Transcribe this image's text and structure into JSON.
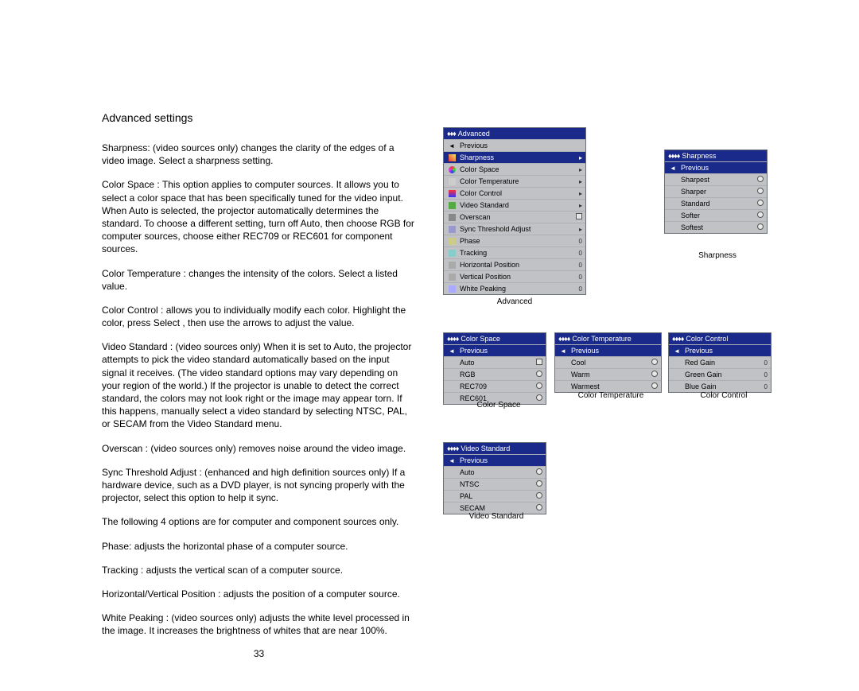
{
  "heading": "Advanced settings",
  "paragraphs": {
    "p1": "Sharpness: (video sources only) changes the clarity of the edges of a video image. Select a sharpness setting.",
    "p2": "Color Space : This option applies to computer sources. It allows you to select a color space that has been specifically tuned for the video input. When Auto is selected, the projector automatically determines the standard. To choose a different setting, turn off Auto, then choose RGB for computer sources, choose either REC709 or REC601 for component sources.",
    "p3": "Color Temperature   : changes the intensity of the colors. Select a listed value.",
    "p4": "Color Control   : allows you to individually modify each color. Highlight the color, press Select , then use the arrows to adjust the value.",
    "p5": "Video Standard  : (video sources only) When it is set to Auto, the projector attempts to pick the video standard automatically based on the input signal it receives. (The video standard options may vary depending on your region of the world.) If the projector is unable to detect the correct standard, the colors may not look right or the image may appear  torn.  If this happens, manually select a video standard by selecting NTSC, PAL, or SECAM from the Video Standard menu.",
    "p6": "Overscan : (video sources only) removes noise around the video image.",
    "p7": "Sync Threshold Adjust  : (enhanced and high definition sources only) If a hardware device, such as a DVD player, is not syncing properly with the projector, select this option to help it sync.",
    "p8": "The following 4 options are for computer and component sources only.",
    "p9": "Phase: adjusts the horizontal phase of a computer source.",
    "p10": "Tracking : adjusts the vertical scan of a computer source.",
    "p11": "Horizontal/Vertical Position    : adjusts the position of a computer source.",
    "p12": "White Peaking  : (video sources only) adjusts the white level processed in the image. It increases the brightness of whites that are near 100%."
  },
  "pageNumber": "33",
  "menus": {
    "advanced": {
      "title": "Advanced",
      "diam": "♦♦♦",
      "items": [
        {
          "label": "Previous",
          "icon": "prev",
          "ind": ""
        },
        {
          "label": "Sharpness",
          "icon": "sharp",
          "ind": "▸",
          "sel": true
        },
        {
          "label": "Color Space",
          "icon": "cs",
          "ind": "▸"
        },
        {
          "label": "Color Temperature",
          "icon": "ct",
          "ind": "▸"
        },
        {
          "label": "Color Control",
          "icon": "cc",
          "ind": "▸"
        },
        {
          "label": "Video Standard",
          "icon": "vs",
          "ind": "▸"
        },
        {
          "label": "Overscan",
          "icon": "os",
          "ind": "check"
        },
        {
          "label": "Sync Threshold Adjust",
          "icon": "st",
          "ind": "▸"
        },
        {
          "label": "Phase",
          "icon": "ph",
          "ind": "0"
        },
        {
          "label": "Tracking",
          "icon": "tr",
          "ind": "0"
        },
        {
          "label": "Horizontal Position",
          "icon": "hp",
          "ind": "0"
        },
        {
          "label": "Vertical Position",
          "icon": "vp",
          "ind": "0"
        },
        {
          "label": "White Peaking",
          "icon": "wp",
          "ind": "0"
        }
      ],
      "caption": "Advanced"
    },
    "sharpness": {
      "title": "Sharpness",
      "diam": "♦♦♦♦",
      "items": [
        {
          "label": "Previous",
          "sel": true,
          "ind": ""
        },
        {
          "label": "Sharpest",
          "ind": "radio"
        },
        {
          "label": "Sharper",
          "ind": "radio"
        },
        {
          "label": "Standard",
          "ind": "radio"
        },
        {
          "label": "Softer",
          "ind": "radio"
        },
        {
          "label": "Softest",
          "ind": "radio"
        }
      ],
      "caption": "Sharpness"
    },
    "colorspace": {
      "title": "Color Space",
      "diam": "♦♦♦♦",
      "items": [
        {
          "label": "Previous",
          "sel": true,
          "ind": ""
        },
        {
          "label": "Auto",
          "ind": "check"
        },
        {
          "label": "RGB",
          "ind": "radio"
        },
        {
          "label": "REC709",
          "ind": "radio"
        },
        {
          "label": "REC601",
          "ind": "radio"
        }
      ],
      "caption": "Color Space"
    },
    "colortemp": {
      "title": "Color Temperature",
      "diam": "♦♦♦♦",
      "items": [
        {
          "label": "Previous",
          "sel": true,
          "ind": ""
        },
        {
          "label": "Cool",
          "ind": "radio"
        },
        {
          "label": "Warm",
          "ind": "radio"
        },
        {
          "label": "Warmest",
          "ind": "radio"
        }
      ],
      "caption": "Color Temperature"
    },
    "colorcontrol": {
      "title": "Color Control",
      "diam": "♦♦♦♦",
      "items": [
        {
          "label": "Previous",
          "sel": true,
          "ind": ""
        },
        {
          "label": "Red Gain",
          "ind": "0"
        },
        {
          "label": "Green Gain",
          "ind": "0"
        },
        {
          "label": "Blue Gain",
          "ind": "0"
        }
      ],
      "caption": "Color Control"
    },
    "videostd": {
      "title": "Video Standard",
      "diam": "♦♦♦♦",
      "items": [
        {
          "label": "Previous",
          "sel": true,
          "ind": ""
        },
        {
          "label": "Auto",
          "ind": "radio"
        },
        {
          "label": "NTSC",
          "ind": "radio"
        },
        {
          "label": "PAL",
          "ind": "radio"
        },
        {
          "label": "SECAM",
          "ind": "radio"
        }
      ],
      "caption": "Video Standard"
    }
  }
}
